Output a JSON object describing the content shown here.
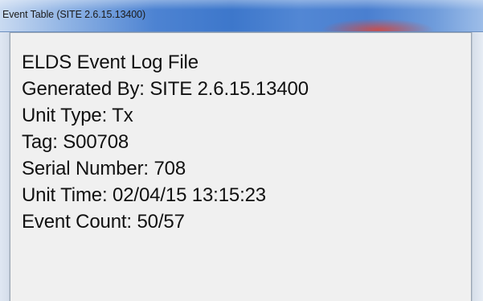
{
  "window": {
    "title": "Event Table (SITE 2.6.15.13400)"
  },
  "log": {
    "lines": [
      "ELDS Event Log File",
      "Generated By: SITE 2.6.15.13400",
      "Unit Type: Tx",
      "Tag: S00708",
      "Serial Number: 708",
      "Unit Time: 02/04/15 13:15:23",
      "Event Count: 50/57"
    ]
  },
  "colors": {
    "titlebar_blue": "#4d83d2",
    "content_background": "#f0f0f0",
    "text": "#111111"
  }
}
